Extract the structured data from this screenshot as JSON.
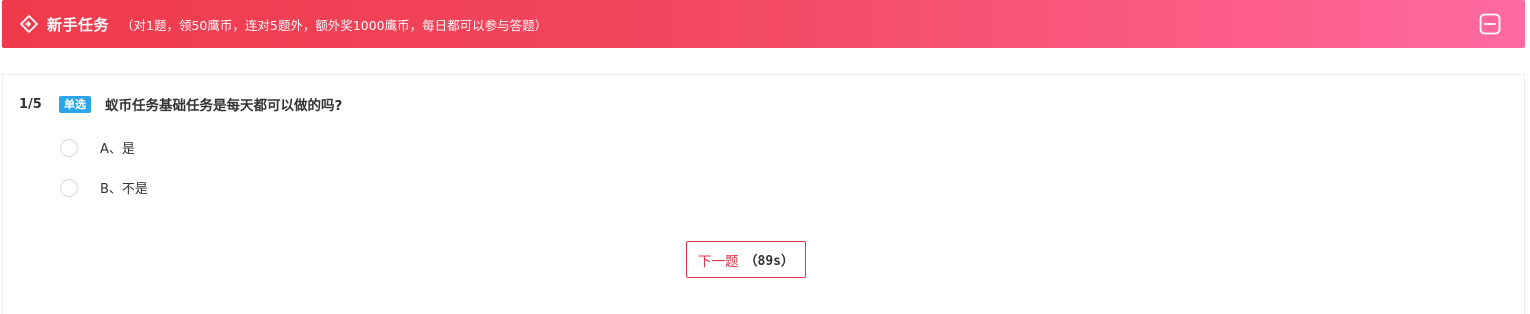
{
  "header": {
    "icon": "diamond-arrow-icon",
    "title": "新手任务",
    "subtitle": "（对1题，领50鹰币，连对5题外，额外奖1000鹰币，每日都可以参与答题）",
    "collapse_icon": "minus-square-icon",
    "gradient": [
      "#ef3a4c",
      "#ff6aa2"
    ]
  },
  "question": {
    "progress": "1/5",
    "type_tag": "单选",
    "text": "蚁币任务基础任务是每天都可以做的吗?",
    "options": [
      {
        "label": "A、是"
      },
      {
        "label": "B、不是"
      }
    ]
  },
  "next_button": {
    "label": "下一题",
    "countdown": "（89s）",
    "accent": "#e0344a"
  }
}
